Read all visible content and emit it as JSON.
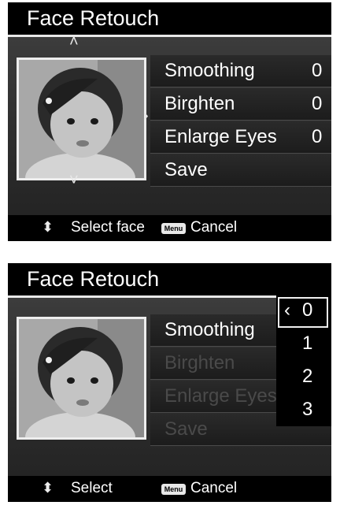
{
  "screen1": {
    "title": "Face Retouch",
    "menu": [
      {
        "label": "Smoothing",
        "value": "0"
      },
      {
        "label": "Birghten",
        "value": "0"
      },
      {
        "label": "Enlarge Eyes",
        "value": "0"
      },
      {
        "label": "Save",
        "value": ""
      }
    ],
    "footer": {
      "arrow_icon": "up-down-arrows-icon",
      "select_label": "Select face",
      "menu_button": "Menu",
      "cancel_label": "Cancel"
    }
  },
  "screen2": {
    "title": "Face Retouch",
    "menu": [
      {
        "label": "Smoothing"
      },
      {
        "label": "Birghten"
      },
      {
        "label": "Enlarge Eyes"
      },
      {
        "label": "Save"
      }
    ],
    "options": [
      "0",
      "1",
      "2",
      "3"
    ],
    "selected_glyph": "‹",
    "footer": {
      "arrow_icon": "up-down-arrows-icon",
      "select_label": "Select",
      "menu_button": "Menu",
      "cancel_label": "Cancel"
    }
  }
}
